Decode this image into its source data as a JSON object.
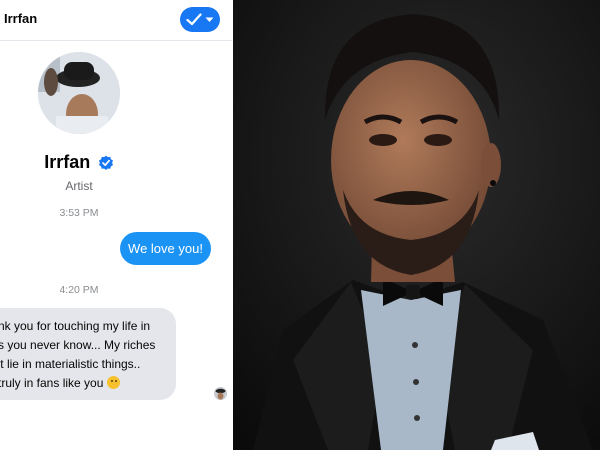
{
  "chat": {
    "header_name": "Irrfan",
    "profile_name": "Irrfan",
    "profile_role": "Artist",
    "messages": [
      {
        "time": "3:53 PM",
        "direction": "outgoing",
        "text": "We love you!"
      },
      {
        "time": "4:20 PM",
        "direction": "incoming",
        "lines": [
          "nk you for touching my life in",
          "s you never know... My riches",
          "'t lie in materialistic things..",
          "truly in fans like you"
        ]
      }
    ]
  },
  "icons": {
    "header_button": "checkmark-dropdown-icon",
    "verified": "verified-badge-icon",
    "emoji": "smiley-emoji-icon"
  },
  "colors": {
    "accent": "#1877f2",
    "outgoing_bubble": "#1b93f5",
    "incoming_bubble": "#e4e6eb"
  }
}
